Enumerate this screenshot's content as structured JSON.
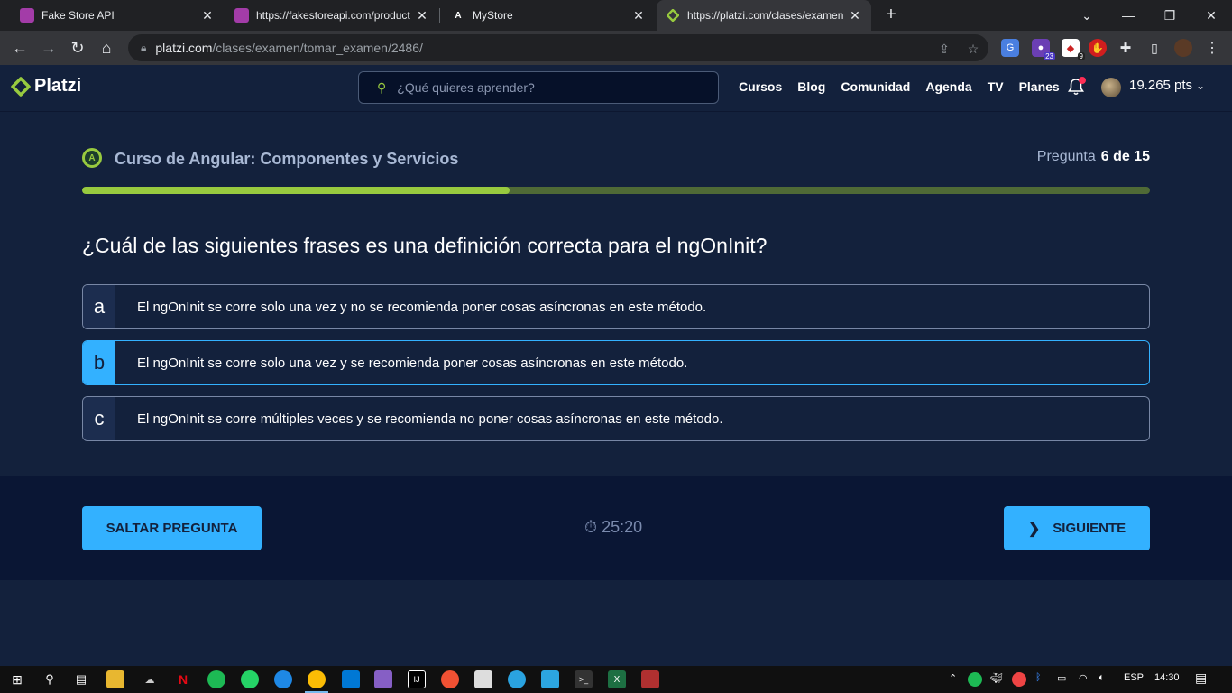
{
  "browser": {
    "tabs": [
      {
        "label": "Fake Store API",
        "favicon_color": "#a33ca8"
      },
      {
        "label": "https://fakestoreapi.com/product",
        "favicon_color": "#a33ca8"
      },
      {
        "label": "MyStore",
        "favicon_glyph": "A"
      },
      {
        "label": "https://platzi.com/clases/examen",
        "favicon_color": "#98ca3f"
      }
    ],
    "url_host": "platzi.com",
    "url_path": "/clases/examen/tomar_examen/2486/",
    "extension_badges": [
      "23",
      "9"
    ]
  },
  "site": {
    "logo_text": "Platzi",
    "search_placeholder": "¿Qué quieres aprender?",
    "nav": [
      "Cursos",
      "Blog",
      "Comunidad",
      "Agenda",
      "TV",
      "Planes"
    ],
    "points": "19.265 pts"
  },
  "exam": {
    "course_title": "Curso de Angular: Componentes y Servicios",
    "counter_label": "Pregunta",
    "counter_value": "6 de 15",
    "progress": 0.4,
    "question": "¿Cuál de las siguientes frases es una definición correcta para el ngOnInit?",
    "options": [
      {
        "letter": "a",
        "text": "El ngOnInit se corre solo una vez y no se recomienda poner cosas asíncronas en este método.",
        "selected": false
      },
      {
        "letter": "b",
        "text": "El ngOnInit se corre solo una vez y se recomienda poner cosas asíncronas en este método.",
        "selected": true
      },
      {
        "letter": "c",
        "text": "El ngOnInit se corre múltiples veces y se recomienda no poner cosas asíncronas en este método.",
        "selected": false
      }
    ],
    "skip_label": "SALTAR PREGUNTA",
    "timer": "25:20",
    "next_label": "SIGUIENTE"
  },
  "taskbar": {
    "language": "ESP",
    "time": "14:30"
  },
  "colors": {
    "accent": "#98ca3f",
    "button": "#33b1ff",
    "background": "#13213c"
  }
}
